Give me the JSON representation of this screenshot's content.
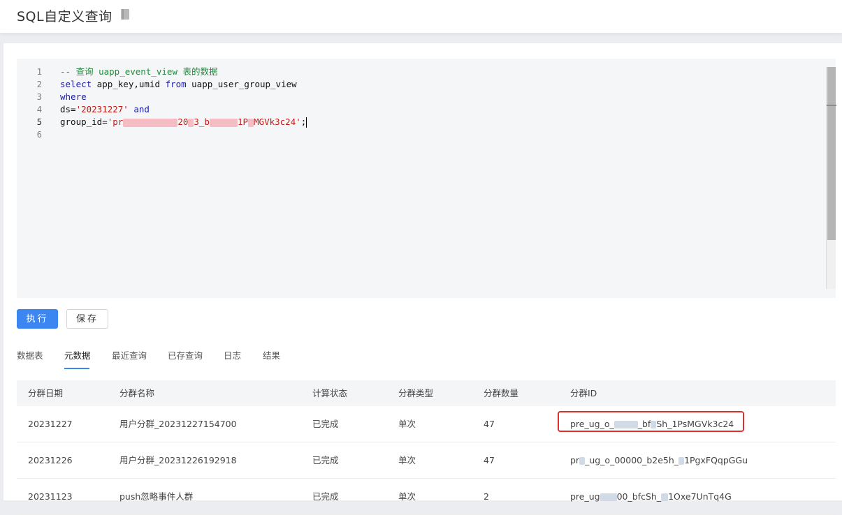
{
  "header": {
    "title": "SQL自定义查询"
  },
  "editor": {
    "line_numbers": [
      "1",
      "2",
      "3",
      "4",
      "5",
      "6"
    ],
    "lines": {
      "l1_comment": "-- 查询 uapp_event_view 表的数据",
      "l2_kw1": "select",
      "l2_text": " app_key,umid ",
      "l2_kw2": "from",
      "l2_text2": " uapp_user_group_view",
      "l3_kw": "where",
      "l4_text": "ds=",
      "l4_str": "'20231227'",
      "l4_kw": " and",
      "l5_text": "group_id=",
      "l5_str_start": "'pr",
      "l5_str_mid1": "20",
      "l5_str_mid2": "3_b",
      "l5_str_mid3": "1P",
      "l5_str_end": "MGVk3c24'",
      "l5_semi": ";"
    }
  },
  "buttons": {
    "run": "执行",
    "save": "保存"
  },
  "tabs": [
    {
      "label": "数据表"
    },
    {
      "label": "元数据"
    },
    {
      "label": "最近查询"
    },
    {
      "label": "已存查询"
    },
    {
      "label": "日志"
    },
    {
      "label": "结果"
    }
  ],
  "table": {
    "headers": [
      "分群日期",
      "分群名称",
      "计算状态",
      "分群类型",
      "分群数量",
      "分群ID"
    ],
    "rows": [
      {
        "date": "20231227",
        "name": "用户分群_20231227154700",
        "status": "已完成",
        "type": "单次",
        "count": "47",
        "id_a": "pre_ug_o_",
        "id_b": "_bf",
        "id_c": "Sh_1PsMGVk3c24"
      },
      {
        "date": "20231226",
        "name": "用户分群_20231226192918",
        "status": "已完成",
        "type": "单次",
        "count": "47",
        "id_a": "pr",
        "id_b": "_ug_o_00000_b2e5h_",
        "id_c": "1PgxFQqpGGu"
      },
      {
        "date": "20231123",
        "name": "push忽略事件人群",
        "status": "已完成",
        "type": "单次",
        "count": "2",
        "id_a": "pre_ug",
        "id_b": "00_bfcSh_",
        "id_c": "1Oxe7UnTq4G"
      }
    ]
  },
  "colors": {
    "accent": "#3b86f0",
    "highlight": "#e0302e",
    "keyword": "#1a1aa6",
    "string": "#c41a16",
    "comment": "#23883d"
  }
}
